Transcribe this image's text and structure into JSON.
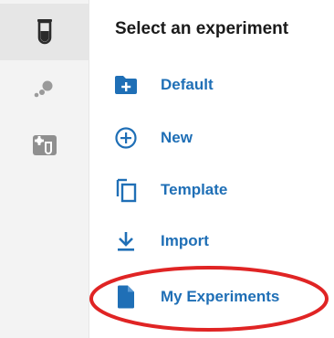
{
  "colors": {
    "accent": "#1f6fb6",
    "rail_background": "#f3f3f3",
    "rail_active": "#e6e6e6",
    "highlight": "#e02424"
  },
  "rail": {
    "items": [
      {
        "icon": "test-tube-icon",
        "active": true
      },
      {
        "icon": "molecule-dots-icon",
        "active": false
      },
      {
        "icon": "lab-equipment-icon",
        "active": false
      }
    ]
  },
  "panel": {
    "title": "Select an experiment",
    "items": [
      {
        "icon": "folder-plus-icon",
        "label": "Default"
      },
      {
        "icon": "circle-plus-icon",
        "label": "New"
      },
      {
        "icon": "copy-icon",
        "label": "Template"
      },
      {
        "icon": "download-icon",
        "label": "Import"
      },
      {
        "icon": "document-icon",
        "label": "My Experiments"
      }
    ]
  },
  "annotation": {
    "type": "ellipse",
    "target": "My Experiments"
  }
}
